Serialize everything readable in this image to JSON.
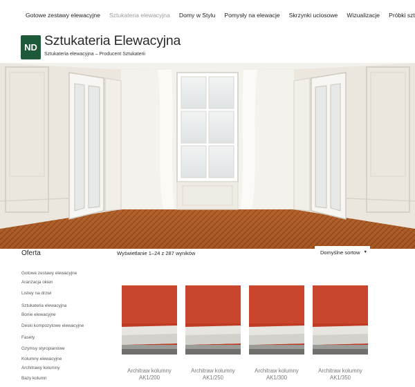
{
  "nav": {
    "items": [
      {
        "label": "Gotowe zestawy elewacyjne",
        "active": false
      },
      {
        "label": "Sztukateria elewacyjna",
        "active": true
      },
      {
        "label": "Domy w Stylu",
        "active": false
      },
      {
        "label": "Pomysły na elewacje",
        "active": false
      },
      {
        "label": "Skrzynki uciosowe",
        "active": false
      },
      {
        "label": "Wizualizacje",
        "active": false
      },
      {
        "label": "Próbki sztukaterii",
        "active": false
      }
    ]
  },
  "brand": {
    "logo_text": "ND",
    "logo_color": "#1e5a3a",
    "title": "Sztukateria Elewacyjna",
    "tagline": "Sztukateria elewacyjna – Producent Sztukaterii"
  },
  "sidebar": {
    "heading": "Oferta",
    "items": [
      "Gotowe zestawy elewacyjne",
      "Aranżacja okien",
      "Listwy na drzwi",
      "Sztukateria elewacyjna",
      "Boniе elewacyjne",
      "Deski kompozytowe elewacyjne",
      "Fasety",
      "Gzymsy styropianowe",
      "Kolumny elewacyjne",
      "Architrawy kolumny",
      "Bazy kolumn"
    ]
  },
  "shop": {
    "result_count": "Wyświetlanie 1–24 z 287 wyników",
    "sort_label": "Domyślne sortow"
  },
  "products": [
    {
      "name_line1": "Architraw kolumny",
      "name_line2": "AK1/200"
    },
    {
      "name_line1": "Architraw kolumny",
      "name_line2": "AK1/250"
    },
    {
      "name_line1": "Architraw kolumny",
      "name_line2": "AK1/300"
    },
    {
      "name_line1": "Architraw kolumny",
      "name_line2": "AK1/350"
    }
  ]
}
